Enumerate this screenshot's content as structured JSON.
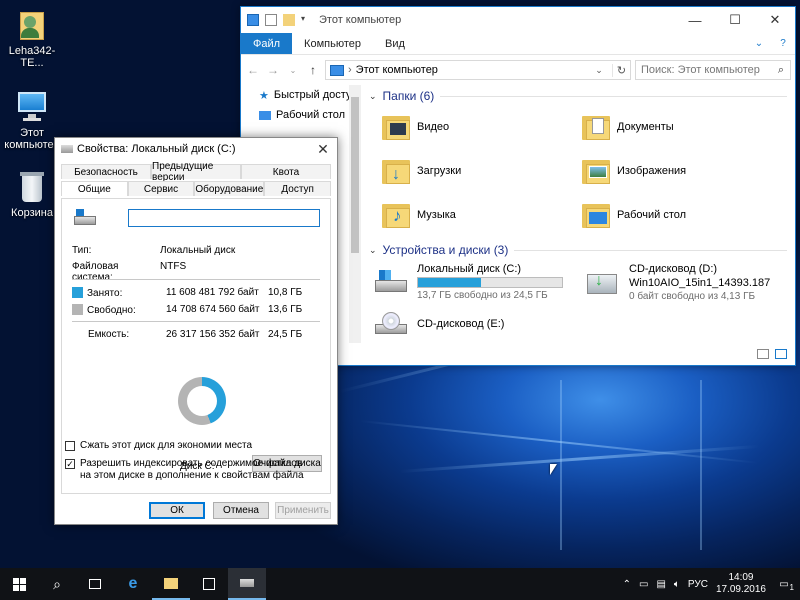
{
  "desktop": {
    "icons": [
      {
        "label": "Leha342-TE..."
      },
      {
        "label": "Этот компьютер"
      },
      {
        "label": "Корзина"
      }
    ]
  },
  "explorer": {
    "title": "Этот компьютер",
    "ribbon_tabs": [
      "Файл",
      "Компьютер",
      "Вид"
    ],
    "address": "Этот компьютер",
    "search_placeholder": "Поиск: Этот компьютер",
    "nav_items": [
      "Быстрый доступ",
      "Рабочий стол"
    ],
    "folders_header": "Папки (6)",
    "folders": [
      "Видео",
      "Документы",
      "Загрузки",
      "Изображения",
      "Музыка",
      "Рабочий стол"
    ],
    "devices_header": "Устройства и диски (3)",
    "drives": [
      {
        "name": "Локальный диск (C:)",
        "sub": "13,7 ГБ свободно из 24,5 ГБ",
        "used_fraction": 0.44
      },
      {
        "name": "CD-дисковод (D:)",
        "label2": "Win10AIO_15in1_14393.187",
        "sub": "0 байт свободно из 4,13 ГБ"
      },
      {
        "name": "CD-дисковод (E:)"
      }
    ]
  },
  "props": {
    "title": "Свойства: Локальный диск (C:)",
    "tabs_row1": [
      "Безопасность",
      "Предыдущие версии",
      "Квота"
    ],
    "tabs_row2": [
      "Общие",
      "Сервис",
      "Оборудование",
      "Доступ"
    ],
    "type_label": "Тип:",
    "type_value": "Локальный диск",
    "fs_label": "Файловая система:",
    "fs_value": "NTFS",
    "used_label": "Занято:",
    "used_bytes": "11 608 481 792 байт",
    "used_gb": "10,8 ГБ",
    "free_label": "Свободно:",
    "free_bytes": "14 708 674 560 байт",
    "free_gb": "13,6 ГБ",
    "cap_label": "Емкость:",
    "cap_bytes": "26 317 156 352 байт",
    "cap_gb": "24,5 ГБ",
    "disk_label": "Диск C:",
    "cleanup_button": "Очистка диска",
    "compress_label": "Сжать этот диск для экономии места",
    "index_label": "Разрешить индексировать содержимое файлов на этом диске в дополнение к свойствам файла",
    "ok": "ОК",
    "cancel": "Отмена",
    "apply": "Применить",
    "used_color": "#26a0da",
    "free_color": "#b4b4b4"
  },
  "taskbar": {
    "lang": "РУС",
    "time": "14:09",
    "date": "17.09.2016",
    "notif_count": "1"
  }
}
